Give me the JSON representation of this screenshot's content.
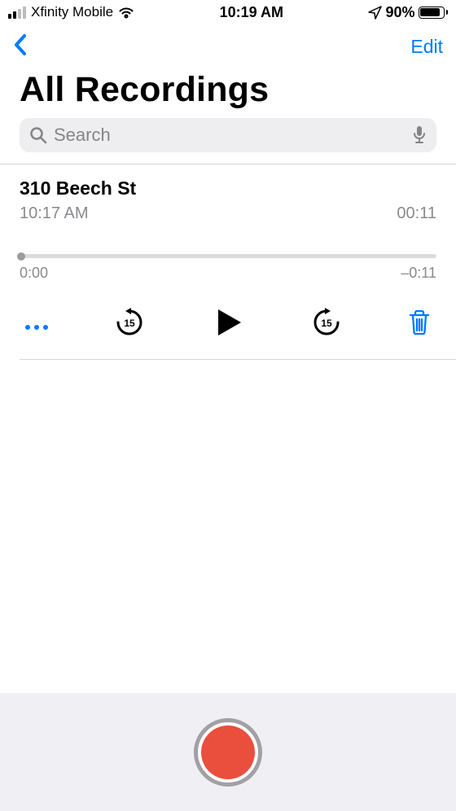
{
  "status_bar": {
    "carrier": "Xfinity Mobile",
    "time": "10:19 AM",
    "battery_pct": "90%"
  },
  "nav": {
    "edit": "Edit"
  },
  "title": "All Recordings",
  "search": {
    "placeholder": "Search"
  },
  "recording": {
    "title": "310 Beech St",
    "time": "10:17 AM",
    "duration": "00:11",
    "elapsed": "0:00",
    "remaining": "–0:11"
  }
}
